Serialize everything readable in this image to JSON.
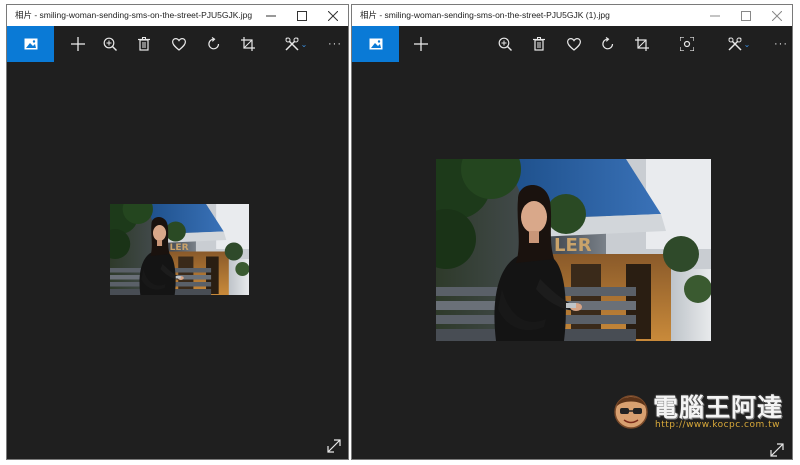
{
  "windows": [
    {
      "id": "left",
      "title": "相片 - smiling-woman-sending-sms-on-the-street-PJU5GJK.jpg",
      "controls": [
        "minimize",
        "maximize",
        "close"
      ],
      "toolbar": [
        "image-mode-icon",
        "add-icon",
        "zoom-in-icon",
        "delete-icon",
        "favorite-heart-icon",
        "rotate-icon",
        "crop-icon",
        "edit-tools-icon",
        "more-options-icon"
      ]
    },
    {
      "id": "right",
      "title": "相片 - smiling-woman-sending-sms-on-the-street-PJU5GJK (1).jpg",
      "controls": [
        "minimize",
        "maximize",
        "close"
      ],
      "toolbar": [
        "image-mode-icon",
        "add-icon",
        "zoom-in-icon",
        "delete-icon",
        "favorite-heart-icon",
        "rotate-icon",
        "crop-icon",
        "camera-focus-icon",
        "edit-tools-icon",
        "more-options-icon"
      ]
    }
  ],
  "toolbar": {
    "more_label": "···",
    "dropdown_label": "⌄"
  },
  "watermark": {
    "title": "電腦王阿達",
    "url": "http://www.kocpc.com.tw"
  },
  "colors": {
    "accent": "#0a7ad6",
    "background": "#1f1f1f",
    "titlebar": "#ffffff",
    "icon": "#e8e8e8"
  }
}
